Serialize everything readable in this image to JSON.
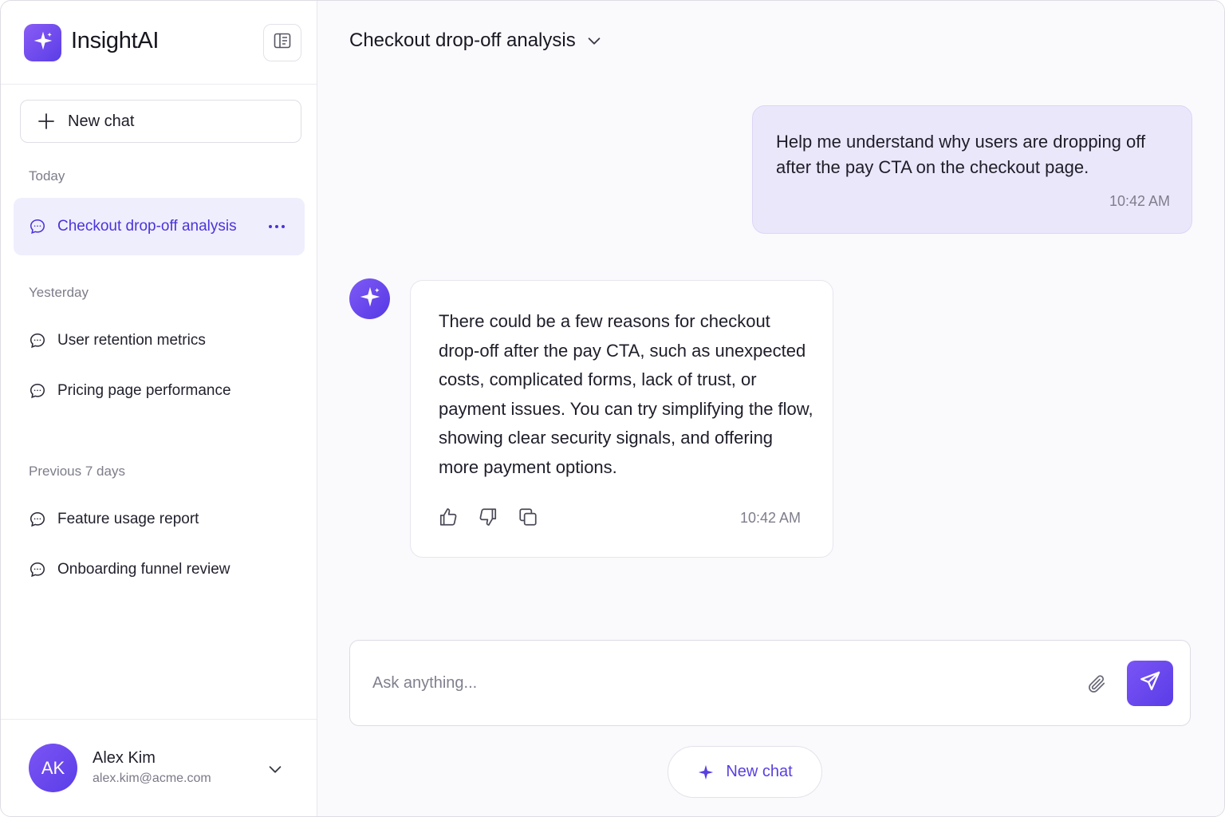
{
  "app": {
    "name": "InsightAI",
    "accent": "#5b3fe6"
  },
  "sidebar": {
    "new_chat_label": "New chat",
    "groups": [
      {
        "label": "Today",
        "items": [
          {
            "label": "Checkout drop-off analysis",
            "active": true
          }
        ]
      },
      {
        "label": "Yesterday",
        "items": [
          {
            "label": "User retention metrics"
          },
          {
            "label": "Pricing page performance"
          }
        ]
      },
      {
        "label": "Previous 7 days",
        "items": [
          {
            "label": "Feature usage report"
          },
          {
            "label": "Onboarding funnel review"
          }
        ]
      }
    ],
    "user": {
      "initials": "AK",
      "name": "Alex Kim",
      "email": "alex.kim@acme.com"
    }
  },
  "conversation": {
    "title": "Checkout drop-off analysis",
    "messages": [
      {
        "role": "user",
        "text": "Help me understand why users are dropping off after the pay CTA on the checkout page.",
        "time": "10:42 AM"
      },
      {
        "role": "assistant",
        "text": "There could be a few reasons for checkout drop-off after the pay CTA, such as unexpected costs, complicated forms, lack of trust, or payment issues. You can try simplifying the flow, showing clear security signals, and offering more payment options.",
        "time": "10:42 AM"
      }
    ]
  },
  "composer": {
    "placeholder": "Ask anything..."
  },
  "footer": {
    "new_chat_label": "New chat"
  },
  "icons": {
    "logo": "sparkle-icon",
    "collapse": "sidebar-toggle-icon",
    "new_chat": "plus-icon",
    "chat": "chat-bubble-icon",
    "more": "more-horizontal-icon",
    "user_menu": "chevron-down-icon",
    "title_menu": "chevron-down-icon",
    "like": "thumbs-up-icon",
    "dislike": "thumbs-down-icon",
    "copy": "copy-icon",
    "attach": "paperclip-icon",
    "send": "send-icon"
  }
}
